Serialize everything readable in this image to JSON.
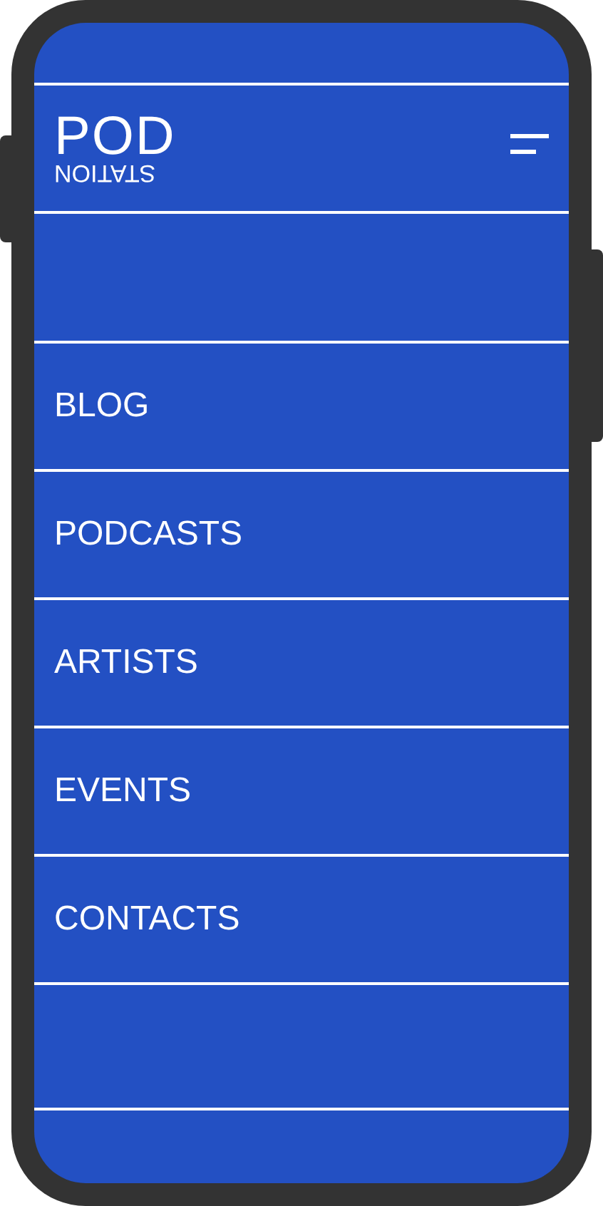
{
  "logo": {
    "top": "POD",
    "bottom": "STATION"
  },
  "menu": [
    {
      "label": "BLOG"
    },
    {
      "label": "PODCASTS"
    },
    {
      "label": "ARTISTS"
    },
    {
      "label": "EVENTS"
    },
    {
      "label": "CONTACTS"
    }
  ]
}
